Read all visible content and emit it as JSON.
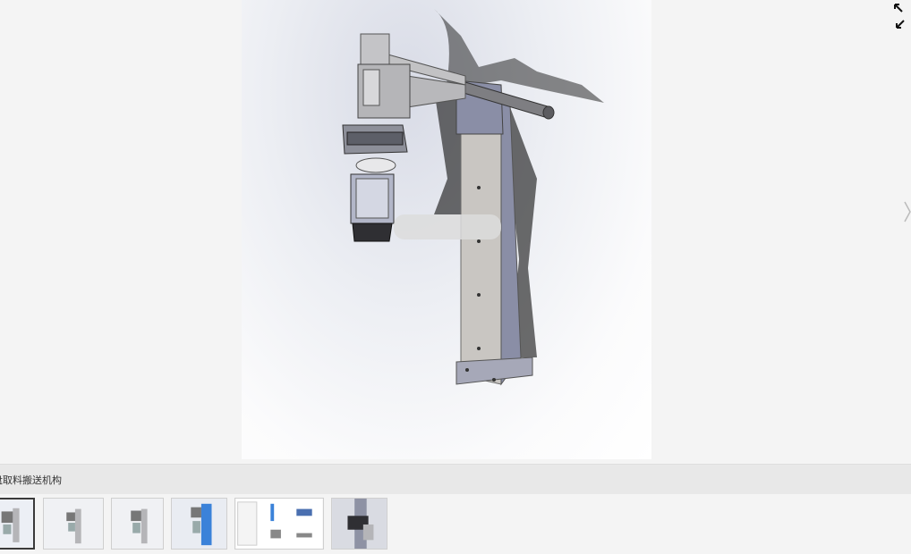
{
  "viewer": {
    "main_image_icon": "cad-render-pick-and-place-mechanism",
    "controls": {
      "fullscreen_icon": "expand-arrows-icon",
      "next_icon": "chevron-right-icon"
    }
  },
  "caption": {
    "text": "盘取料搬送机构"
  },
  "thumbnails": [
    {
      "label": "",
      "icon": "render-thumb",
      "active": true
    },
    {
      "label": "",
      "icon": "render-thumb",
      "active": false
    },
    {
      "label": "",
      "icon": "render-thumb",
      "active": false
    },
    {
      "label": "",
      "icon": "blue-render-thumb",
      "active": false
    },
    {
      "label": "",
      "icon": "drawing-sheet-thumb",
      "active": false
    },
    {
      "label": "",
      "icon": "closeup-render-thumb",
      "active": false
    }
  ],
  "colors": {
    "page_bg": "#f4f4f4",
    "caption_bg": "#e8e8e8",
    "metal": "#c9c9cc",
    "accent_blue": "#3b82d9"
  }
}
